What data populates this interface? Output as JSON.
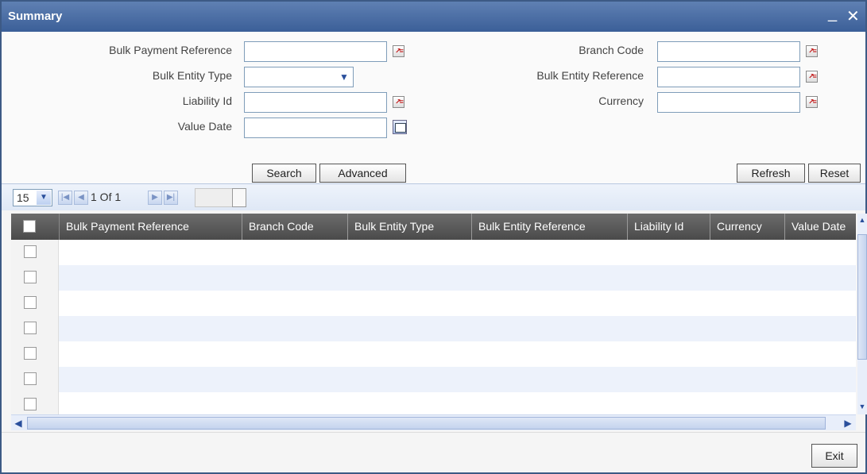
{
  "window": {
    "title": "Summary",
    "minimize_glyph": "_",
    "close_glyph": "✕"
  },
  "form": {
    "bulk_payment_reference": {
      "label": "Bulk Payment Reference",
      "value": ""
    },
    "bulk_entity_type": {
      "label": "Bulk Entity Type",
      "value": ""
    },
    "liability_id": {
      "label": "Liability Id",
      "value": ""
    },
    "value_date": {
      "label": "Value Date",
      "value": ""
    },
    "branch_code": {
      "label": "Branch Code",
      "value": ""
    },
    "bulk_entity_reference": {
      "label": "Bulk Entity Reference",
      "value": ""
    },
    "currency": {
      "label": "Currency",
      "value": ""
    }
  },
  "buttons": {
    "search": "Search",
    "advanced": "Advanced",
    "refresh": "Refresh",
    "reset": "Reset",
    "exit": "Exit"
  },
  "pager": {
    "page_size": "15",
    "page_info": "1 Of 1"
  },
  "grid": {
    "columns": [
      "Bulk Payment Reference",
      "Branch Code",
      "Bulk Entity Type",
      "Bulk Entity Reference",
      "Liability Id",
      "Currency",
      "Value Date"
    ]
  },
  "icons": {
    "lov": "lov-icon",
    "calendar": "calendar-icon",
    "dropdown": "chevron-down-icon",
    "first": "first-page-icon",
    "prev": "prev-page-icon",
    "next": "next-page-icon",
    "last": "last-page-icon"
  },
  "colors": {
    "titlebar": "#3b5f98",
    "grid_header": "#4a4a4a",
    "row_alt": "#edf2fb"
  }
}
